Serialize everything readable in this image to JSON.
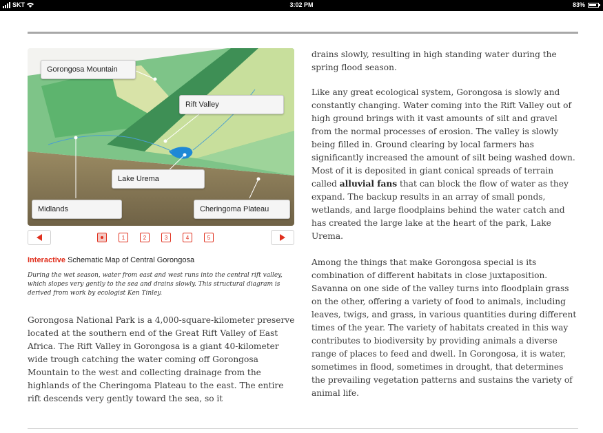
{
  "status_bar": {
    "carrier": "SKT",
    "time": "3:02 PM",
    "battery": "83%",
    "battery_level": 0.83
  },
  "map": {
    "labels": {
      "gorongosa_mountain": "Gorongosa Mountain",
      "rift_valley": "Rift Valley",
      "lake_urema": "Lake Urema",
      "midlands": "Midlands",
      "cheringoma_plateau": "Cheringoma Plateau"
    }
  },
  "pager": {
    "pages": [
      "1",
      "2",
      "3",
      "4",
      "5"
    ],
    "active_index": 0
  },
  "caption": {
    "tag": "Interactive",
    "title": " Schematic Map of Central Gorongosa",
    "text": "During the wet season, water from east and west runs into the central rift valley, which slopes very gently to the sea and drains slowly. This structural diagram is derived from work by ecologist Ken Tinley."
  },
  "left_body": "Gorongosa National Park is a 4,000-square-kilometer preserve located at the southern end of the Great Rift Valley of East Africa. The Rift Valley in Gorongosa is a giant 40-kilometer wide trough catching the water coming off Gorongosa Mountain to the west and collecting drainage from the highlands of the Cheringoma Plateau to the east. The entire rift descends very gently toward the sea, so it",
  "right_body": {
    "p1": "drains slowly, resulting in high standing water during the spring flood season.",
    "p2_before": "Like any great ecological system, Gorongosa is slowly and constantly changing. Water coming into the Rift Valley out of high ground brings with it vast amounts of silt and gravel from the normal processes of erosion. The valley is slowly being filled in. Ground clearing by local farmers has significantly increased the amount of silt being washed down. Most of it is deposited in giant conical spreads of terrain called ",
    "p2_bold": "alluvial fans",
    "p2_after": " that can block the flow of water as they expand. The backup results in an array of small ponds, wetlands, and large floodplains behind the water catch and has created the large lake at the heart of the park, Lake Urema.",
    "p3": "Among the things that make Gorongosa special is its combination of different habitats in close juxtaposition. Savanna on one side of the valley turns into floodplain grass on the other, offering a variety of food to animals, including leaves, twigs, and grass, in various quantities during different times of the year. The variety of habitats created in this way contributes to biodiversity by providing animals a diverse range of places to feed and dwell. In Gorongosa, it is water, sometimes in flood, sometimes in drought, that determines the prevailing vegetation patterns and sustains the variety of animal life."
  }
}
